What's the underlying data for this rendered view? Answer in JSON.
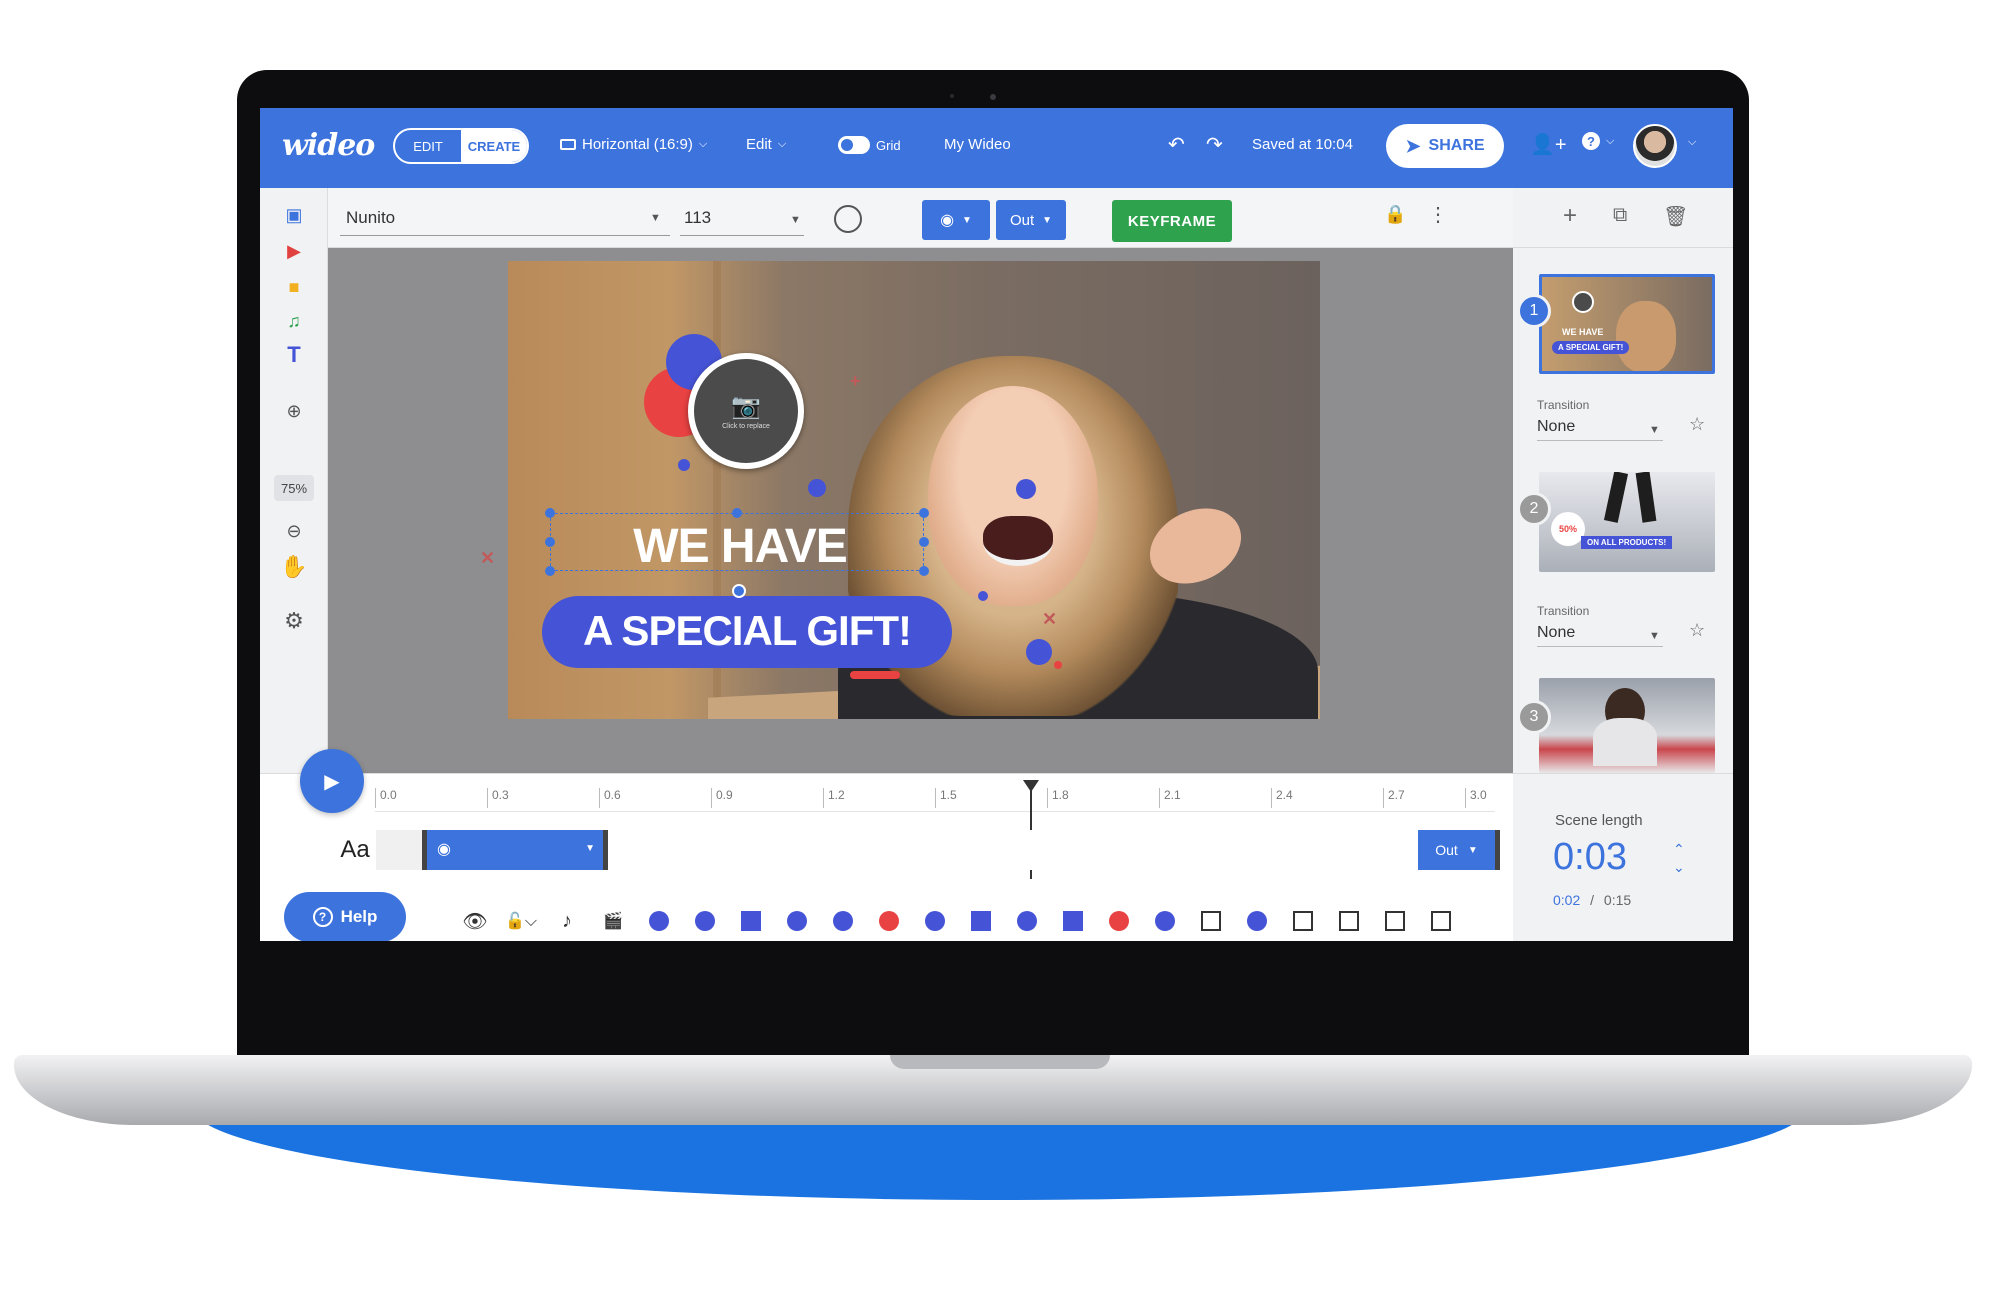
{
  "app": {
    "logo": "wideo",
    "mode_edit": "EDIT",
    "mode_create": "CREATE",
    "format": "Horizontal (16:9)",
    "edit_menu": "Edit",
    "grid_label": "Grid",
    "project_name": "My Wideo",
    "saved_status": "Saved at 10:04",
    "share_label": "SHARE"
  },
  "toolbar": {
    "font_name": "Nunito",
    "font_size": "113",
    "out_label": "Out",
    "keyframe_label": "KEYFRAME"
  },
  "left_tools": {
    "zoom_level": "75%"
  },
  "canvas": {
    "title_line1": "WE HAVE",
    "title_line2": "A SPECIAL GIFT!",
    "photo_placeholder": "Click to replace"
  },
  "scenes": [
    {
      "number": "1",
      "transition_label": "Transition",
      "transition_value": "None",
      "thumb_line1": "WE HAVE",
      "thumb_line2": "A SPECIAL GIFT!"
    },
    {
      "number": "2",
      "transition_label": "Transition",
      "transition_value": "None",
      "thumb_badge": "50%",
      "thumb_banner": "ON ALL PRODUCTS!"
    },
    {
      "number": "3"
    }
  ],
  "timeline": {
    "ticks": [
      "0.0",
      "0.3",
      "0.6",
      "0.9",
      "1.2",
      "1.5",
      "1.8",
      "2.1",
      "2.4",
      "2.7",
      "3.0"
    ],
    "track_label": "Aa",
    "out_label": "Out",
    "help_label": "Help",
    "scene_length_label": "Scene length",
    "scene_length_value": "0:03",
    "current_time": "0:02",
    "total_time": "0:15",
    "time_separator": "/"
  },
  "colors": {
    "primary": "#3d73dd",
    "keyframe": "#2fa24e",
    "shape_blue": "#4553d6",
    "shape_red": "#e84242"
  }
}
